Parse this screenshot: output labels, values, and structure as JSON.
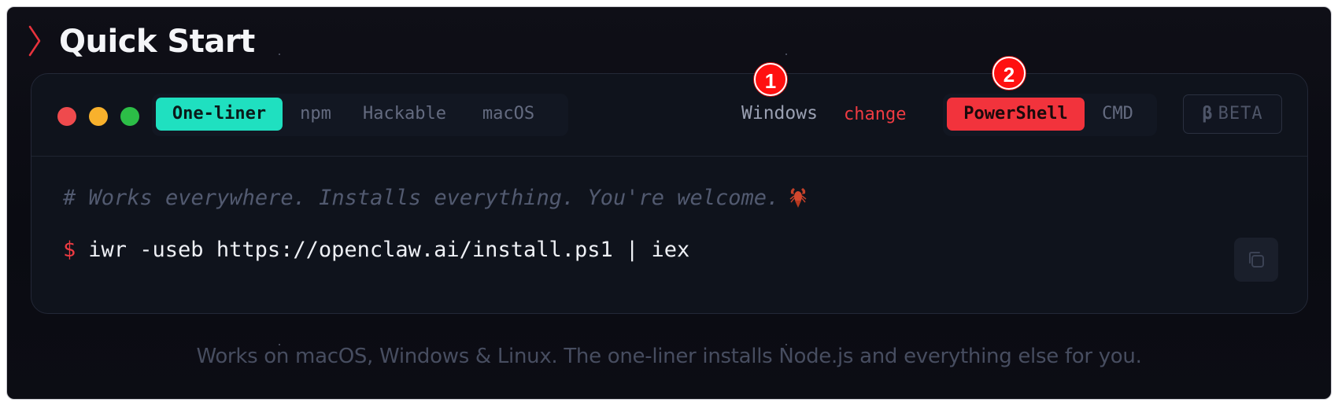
{
  "section": {
    "title": "Quick Start"
  },
  "terminal": {
    "install_tabs": [
      {
        "label": "One-liner",
        "active": true
      },
      {
        "label": "npm",
        "active": false
      },
      {
        "label": "Hackable",
        "active": false
      },
      {
        "label": "macOS",
        "active": false
      }
    ],
    "os": {
      "label": "Windows",
      "change_label": "change"
    },
    "shell_tabs": [
      {
        "label": "PowerShell",
        "active": true
      },
      {
        "label": "CMD",
        "active": false
      }
    ],
    "beta": {
      "icon": "β",
      "label": "BETA"
    },
    "comment": "# Works everywhere. Installs everything. You're welcome.",
    "prompt": "$",
    "command": "iwr -useb https://openclaw.ai/install.ps1 | iex"
  },
  "footer_note": "Works on macOS, Windows & Linux. The one-liner installs Node.js and everything else for you.",
  "annotations": [
    {
      "label": "1"
    },
    {
      "label": "2"
    }
  ],
  "colors": {
    "accent_teal": "#1fe0c0",
    "accent_red": "#f2333c",
    "background": "#0f0f17"
  }
}
